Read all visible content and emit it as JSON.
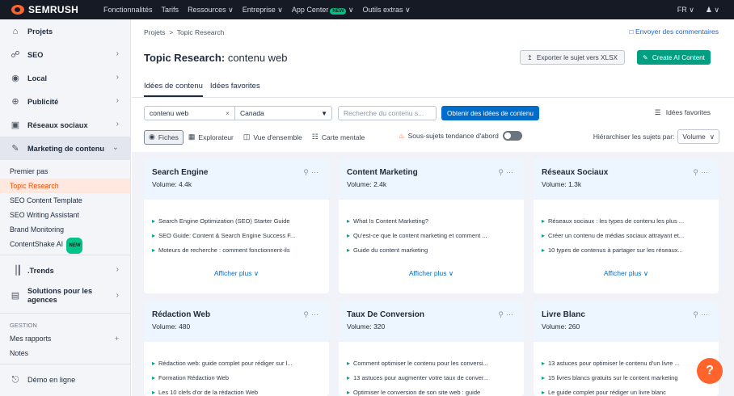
{
  "topbar": {
    "brand": "SEMRUSH",
    "nav": [
      "Fonctionnalités",
      "Tarifs",
      "Ressources",
      "Entreprise",
      "App Center",
      "Outils extras"
    ],
    "app_center_badge": "NEW",
    "lang": "FR",
    "chevron": "∨"
  },
  "sidebar": {
    "items": [
      {
        "label": "Projets",
        "icon": "home-icon"
      },
      {
        "label": "SEO",
        "icon": "seo-icon"
      },
      {
        "label": "Local",
        "icon": "pin-icon"
      },
      {
        "label": "Publicité",
        "icon": "target-icon"
      },
      {
        "label": "Réseaux sociaux",
        "icon": "social-icon"
      },
      {
        "label": "Marketing de contenu",
        "icon": "pen-icon"
      }
    ],
    "subitems": [
      "Premier pas",
      "Topic Research",
      "SEO Content Template",
      "SEO Writing Assistant",
      "Brand Monitoring",
      "ContentShake AI"
    ],
    "contentshake_badge": "NEW",
    "trends": ".Trends",
    "solutions": "Solutions pour les agences",
    "section_label": "GESTION",
    "reports": "Mes rapports",
    "notes": "Notes",
    "demo": "Démo en ligne"
  },
  "main": {
    "breadcrumb": [
      "Projets",
      "Topic Research"
    ],
    "feedback": "Envoyer des commentaires",
    "title_prefix": "Topic Research:",
    "title_topic": "contenu web",
    "export_label": "Exporter le sujet vers XLSX",
    "create_label": "Create AI Content",
    "tabs": [
      "Idées de contenu",
      "Idées favorites"
    ],
    "topic_input": "contenu web",
    "country": "Canada",
    "search_placeholder": "Recherche du contenu s...",
    "get_ideas": "Obtenir des idées de contenu",
    "favorites": "Idées favorites",
    "views": [
      "Fiches",
      "Explorateur",
      "Vue d'ensemble",
      "Carte mentale"
    ],
    "trending_label": "Sous-sujets tendance d'abord",
    "sort_label": "Hiérarchiser les sujets par:",
    "sort_value": "Volume",
    "show_more": "Afficher plus"
  },
  "cards": [
    {
      "title": "Search Engine",
      "volume": "Volume: 4.4k",
      "lines": [
        "Search Engine Optimization (SEO) Starter Guide",
        "SEO Guide: Content & Search Engine Success F...",
        "Moteurs de recherche : comment fonctionnent-ils"
      ]
    },
    {
      "title": "Content Marketing",
      "volume": "Volume: 2.4k",
      "lines": [
        "What Is Content Marketing?",
        "Qu'est-ce que le content marketing et comment ...",
        "Guide du content marketing"
      ]
    },
    {
      "title": "Réseaux Sociaux",
      "volume": "Volume: 1.3k",
      "lines": [
        "Réseaux sociaux : les types de contenu les plus ...",
        "Créer un contenu de médias sociaux attrayant et...",
        "10 types de contenus à partager sur les réseaux..."
      ]
    },
    {
      "title": "Rédaction Web",
      "volume": "Volume: 480",
      "lines": [
        "Rédaction web: guide complet pour rédiger sur l...",
        "Formation Rédaction Web",
        "Les 10 clefs d'or de la rédaction Web"
      ]
    },
    {
      "title": "Taux De Conversion",
      "volume": "Volume: 320",
      "lines": [
        "Comment optimiser le contenu pour les conversi...",
        "13 astuces pour augmenter votre taux de conver...",
        "Optimiser le conversion de son site web : guide"
      ]
    },
    {
      "title": "Livre Blanc",
      "volume": "Volume: 260",
      "lines": [
        "13 astuces pour optimiser le contenu d'un livre ...",
        "15 livres blancs gratuits sur le content marketing",
        "Le guide complet pour rédiger un livre blanc"
      ]
    }
  ],
  "help_label": "?"
}
